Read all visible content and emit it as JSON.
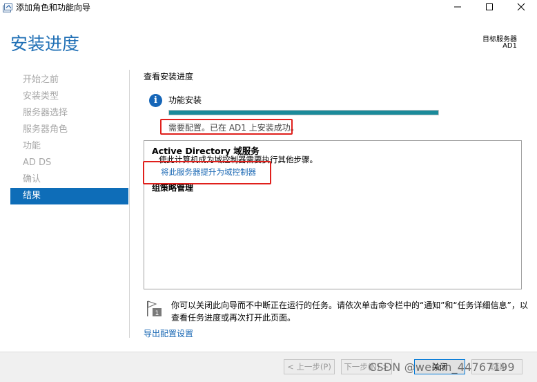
{
  "window": {
    "title": "添加角色和功能向导",
    "minimize_glyph": "—",
    "maximize_glyph": "☐",
    "close_glyph": "✕"
  },
  "header": {
    "title": "安装进度",
    "target_label": "目标服务器",
    "target_value": "AD1"
  },
  "sidebar": {
    "items": [
      {
        "label": "开始之前"
      },
      {
        "label": "安装类型"
      },
      {
        "label": "服务器选择"
      },
      {
        "label": "服务器角色"
      },
      {
        "label": "功能"
      },
      {
        "label": "AD DS"
      },
      {
        "label": "确认"
      },
      {
        "label": "结果"
      }
    ],
    "active_index": 7
  },
  "main": {
    "section_title": "查看安装进度",
    "info_glyph": "i",
    "feature_label": "功能安装",
    "progress_fraction": 1.0,
    "status_text": "需要配置。已在 AD1 上安装成功。",
    "results": {
      "ad_title": "Active Directory 域服务",
      "ad_desc": "使此计算机成为域控制器需要执行其他步骤。",
      "promote_link": "将此服务器提升为域控制器",
      "gp_title": "组策略管理"
    },
    "note_line1": "你可以关闭此向导而不中断正在运行的任务。请依次单击命令栏中的“通知”和“任务详细信息”，以",
    "note_line2": "查看任务进度或再次打开此页面。",
    "export_link": "导出配置设置"
  },
  "footer": {
    "prev": "< 上一步(P)",
    "next": "下一步(N) >",
    "close": "关闭",
    "cancel": "取消"
  },
  "watermark": "CSDN @weixin_44767199",
  "colors": {
    "accent": "#0e6db8",
    "progress": "#1b8a9a",
    "highlight": "#e0201c",
    "link": "#1a68b4"
  }
}
